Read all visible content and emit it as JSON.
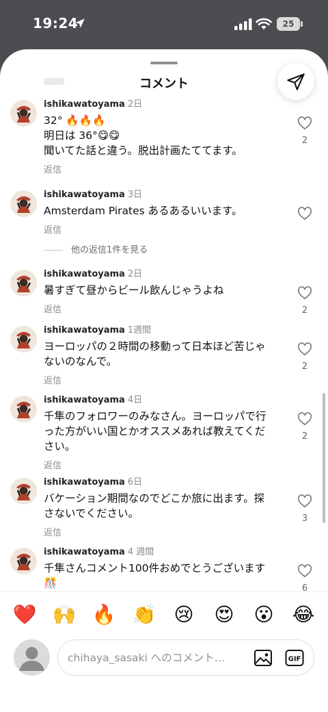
{
  "status_bar": {
    "time": "19:24",
    "battery": "25"
  },
  "header": {
    "title": "コメント",
    "ghost_text": ""
  },
  "comments": [
    {
      "username": "ishikawatoyama",
      "age": "2日",
      "lines": [
        "32° 🔥🔥🔥",
        "明日は 36°😋😋",
        "聞いてた話と違う。脱出計画たててます。"
      ],
      "reply": "返信",
      "likes": "2"
    },
    {
      "username": "ishikawatoyama",
      "age": "3日",
      "lines": [
        "Amsterdam Pirates あるあるいいます。"
      ],
      "reply": "返信",
      "likes": "",
      "more_replies": "他の返信1件を見る"
    },
    {
      "username": "ishikawatoyama",
      "age": "2日",
      "lines": [
        "暑すぎて昼からビール飲んじゃうよね"
      ],
      "reply": "返信",
      "likes": "2"
    },
    {
      "username": "ishikawatoyama",
      "age": "1週間",
      "lines": [
        "ヨーロッパの２時間の移動って日本ほど苦じゃ",
        "ないのなんで。"
      ],
      "reply": "返信",
      "likes": "2"
    },
    {
      "username": "ishikawatoyama",
      "age": "4日",
      "lines": [
        "千隼のフォロワーのみなさん。ヨーロッパで行",
        "った方がいい国とかオススメあれば教えてくだ",
        "さい。"
      ],
      "reply": "返信",
      "likes": "2"
    },
    {
      "username": "ishikawatoyama",
      "age": "6日",
      "lines": [
        "バケーション期間なのでどこか旅に出ます。探",
        "さないでください。"
      ],
      "reply": "返信",
      "likes": "3"
    },
    {
      "username": "ishikawatoyama",
      "age": "4 週間",
      "lines": [
        "千隼さんコメント100件おめでとうございます",
        "🎊"
      ],
      "reply": "",
      "likes": "6"
    }
  ],
  "reactions": [
    "❤️",
    "🙌",
    "🔥",
    "👏",
    "😢",
    "😍",
    "😮",
    "😂"
  ],
  "composer": {
    "placeholder": "chihaya_sasaki へのコメント…"
  },
  "colors": {
    "heart": "#e3263c",
    "status_bg": "#4b4d50"
  }
}
